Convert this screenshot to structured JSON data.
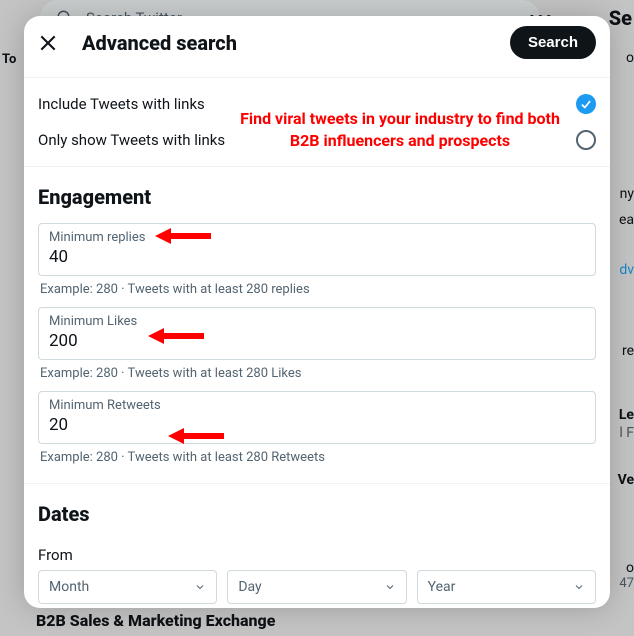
{
  "background": {
    "search_placeholder": "Search Twitter",
    "dots": "•••",
    "frag_se": "Se",
    "frag_to": "To",
    "bottom_text": "B2B Sales & Marketing Exchange",
    "right_frags": [
      "o",
      "ny",
      "ea",
      "dv",
      "re",
      "Le",
      "l F",
      "Ve",
      "o",
      "47"
    ]
  },
  "modal": {
    "title": "Advanced search",
    "search_button": "Search",
    "include_links_label": "Include Tweets with links",
    "only_links_label": "Only show Tweets with links",
    "engagement_title": "Engagement",
    "fields": {
      "min_replies": {
        "label": "Minimum replies",
        "value": "40",
        "hint": "Example: 280 · Tweets with at least 280 replies"
      },
      "min_likes": {
        "label": "Minimum Likes",
        "value": "200",
        "hint": "Example: 280 · Tweets with at least 280 Likes"
      },
      "min_retweets": {
        "label": "Minimum Retweets",
        "value": "20",
        "hint": "Example: 280 · Tweets with at least 280 Retweets"
      }
    },
    "dates_title": "Dates",
    "from_label": "From",
    "date_selects": {
      "month": "Month",
      "day": "Day",
      "year": "Year"
    }
  },
  "annotation": {
    "text": "Find viral tweets in your industry to find both B2B influencers and prospects"
  }
}
